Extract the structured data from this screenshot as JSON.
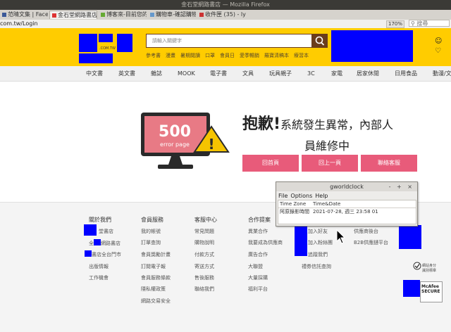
{
  "browser": {
    "window_title": "金石堂網路書店 — Mozilla Firefox",
    "tabs": [
      {
        "label": "范晴文集 | Face"
      },
      {
        "label": "金石堂網路書店"
      },
      {
        "label": "博客來-目前您的"
      },
      {
        "label": "購物車-確認購物"
      },
      {
        "label": "收件匣 (35) - ly"
      }
    ],
    "url": "com.tw/Login",
    "zoom": "170%",
    "search_placeholder": "搜尋"
  },
  "header": {
    "search_placeholder": "請輸入關鍵字",
    "logo_suffix": ".COM.TW",
    "hotwords": [
      "參考書",
      "漫畫",
      "暑期閱讀",
      "口罩",
      "會員日",
      "愛季暢銷",
      "羅寶清稿本",
      "療習本"
    ]
  },
  "nav": {
    "items": [
      "中文書",
      "英文書",
      "雜誌",
      "MOOK",
      "電子書",
      "文具",
      "玩具親子",
      "3C",
      "家電",
      "居家休閒",
      "日用食品",
      "動漫/文創"
    ]
  },
  "error": {
    "image_code": "500",
    "image_label": "error page",
    "title_big": "抱歉!",
    "title_rest": "系統發生異常，內部人",
    "line2": "員維修中",
    "buttons": [
      "回首頁",
      "回上一頁",
      "聯絡客服"
    ]
  },
  "footer": {
    "columns": [
      {
        "title": "關於我們",
        "links": [
          "堂書店",
          "網路書店",
          "書店全台門市",
          "出版情報",
          "工作機會"
        ]
      },
      {
        "title": "會員服務",
        "links": [
          "我的帳號",
          "訂單查詢",
          "會員獎勵計畫",
          "訂閱電子報",
          "會員服務條款",
          "隱私權政策",
          "網路交易安全"
        ]
      },
      {
        "title": "客服中心",
        "links": [
          "常見問題",
          "購物說明",
          "付款方式",
          "寄送方式",
          "售後服務",
          "聯絡我們"
        ]
      },
      {
        "title": "合作提案",
        "links": [
          "異業合作",
          "我要成為供應商",
          "廣告合作",
          "大聯盟",
          "大量採購",
          "福利平台"
        ]
      }
    ],
    "extra_links": [
      "加入好友",
      "加入粉絲團",
      "追蹤我們",
      "禮券信託查詢"
    ],
    "partner_links": [
      "供應商後台",
      "B2B供應鏈平台"
    ],
    "norton_text": "網站身分 識別標章",
    "mcafee_text": "McAfee SECURE"
  },
  "gworldclock": {
    "title": "gworldclock",
    "controls": "- + ×",
    "menu": [
      "File",
      "Options",
      "Help"
    ],
    "columns": [
      "Time Zone",
      "Time&Date"
    ],
    "row": {
      "zone": "阿原錄影時間",
      "datetime": "2021-07-28, 週三 23:58  01"
    }
  },
  "colors": {
    "header_yellow": "#ffcc00",
    "button_pink": "#e85b7a",
    "search_brown": "#6b3c1c"
  }
}
